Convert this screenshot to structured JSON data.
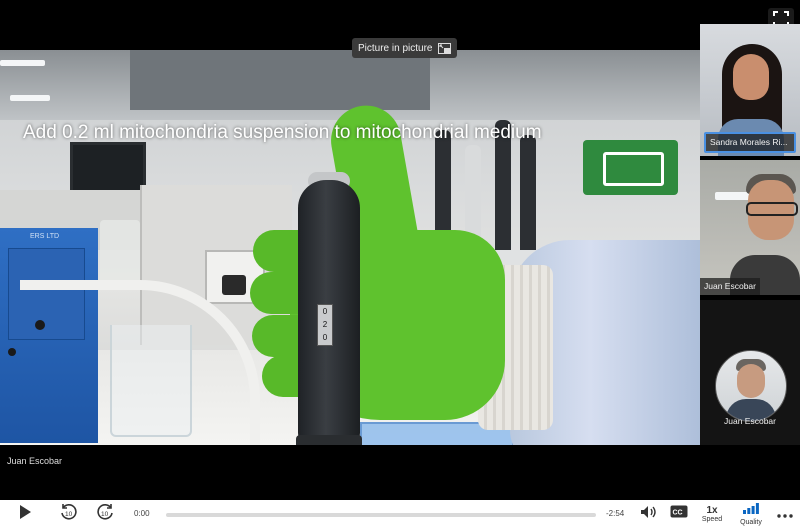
{
  "video": {
    "caption": "Add 0.2 ml mitochondria suspension to mitochondrial medium",
    "counter_digits": [
      "0",
      "2",
      "0"
    ],
    "machine_label": "ERS LTD"
  },
  "tooltip": {
    "pip_label": "Picture in picture"
  },
  "main_speaker": {
    "name": "Juan Escobar"
  },
  "participants": [
    {
      "name": "Sandra Morales Ri..."
    },
    {
      "name": "Juan Escobar"
    },
    {
      "name": "Juan Escobar"
    }
  ],
  "player": {
    "current_time": "0:00",
    "remaining_time": "-2:54",
    "progress": 0.0,
    "speed_value": "1x",
    "speed_label": "Speed",
    "quality_label": "Quality",
    "accent_color": "#0a66c2",
    "icons": [
      "play-icon",
      "rewind-10-icon",
      "forward-10-icon",
      "volume-icon",
      "closed-captions-icon",
      "quality-bars-icon",
      "more-icon",
      "fullscreen-icon",
      "picture-in-picture-icon"
    ]
  }
}
